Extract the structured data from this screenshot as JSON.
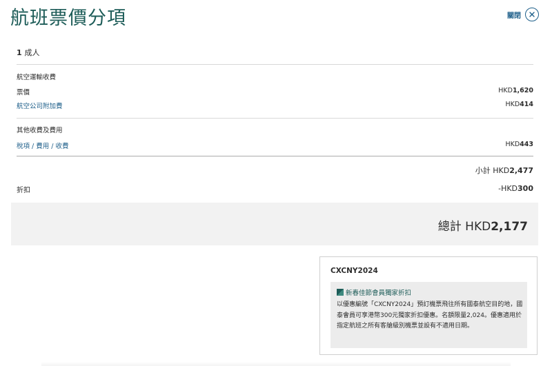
{
  "header": {
    "title": "航班票價分項",
    "close_label": "關閉"
  },
  "passengers": {
    "count": "1",
    "label": "成人"
  },
  "air_transport": {
    "title": "航空運輸收費",
    "items": [
      {
        "label": "票價",
        "currency": "HKD",
        "amount": "1,620"
      },
      {
        "label": "航空公司附加費",
        "currency": "HKD",
        "amount": "414"
      }
    ]
  },
  "other_charges": {
    "title": "其他收費及費用",
    "items": [
      {
        "label": "稅項 / 費用 / 收費",
        "currency": "HKD",
        "amount": "443"
      }
    ]
  },
  "subtotal": {
    "label": "小計 HKD",
    "amount": "2,477"
  },
  "discount": {
    "label": "折扣",
    "currency": "-HKD",
    "amount": "300"
  },
  "total": {
    "label": "總計 HKD",
    "amount": "2,177"
  },
  "promo": {
    "code": "CXCNY2024",
    "headline": "新春佳節會員獨家折扣",
    "body": "以優惠編號「CXCNY2024」預訂機票飛往所有國泰航空目的地，國泰會員可享港幣300元獨家折扣優惠。名額限量2,024。優惠適用於指定航班之所有客艙級別機票並設有不適用日期。"
  },
  "colors": {
    "title": "#1d5c58",
    "link": "#1e5f8a",
    "total_bar": "#f2f2f2",
    "promo_box": "#ececec"
  }
}
